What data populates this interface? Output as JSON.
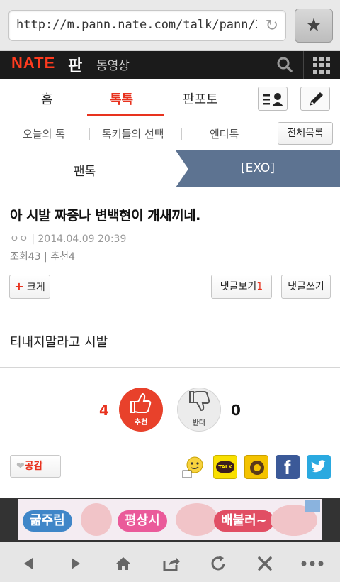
{
  "browser": {
    "url": "http://m.pann.nate.com/talk/pann/3",
    "reload_icon": "reload-icon",
    "star_icon": "star-icon"
  },
  "nate": {
    "logo": "NATE",
    "pan": "판",
    "video": "동영상"
  },
  "tabs": {
    "home": "홈",
    "talk": "톡톡",
    "photo": "판포토"
  },
  "subtabs": {
    "today": "오늘의 톡",
    "choice": "톡커들의 선택",
    "enter": "엔터톡",
    "all_list": "전체목록"
  },
  "breadcrumb": {
    "left": "팬톡",
    "right": "[EXO]"
  },
  "post": {
    "title": "아 시발 짜증나 변백현이 개새끼네.",
    "author": "ㅇㅇ",
    "date": "2014.04.09 20:39",
    "views_label": "조회",
    "views": "43",
    "recommend_label": "추천",
    "recommend": "4",
    "body": "티내지말라고 시발"
  },
  "actions": {
    "bigger_plus": "+",
    "bigger": "크게",
    "view_comments": "댓글보기",
    "comment_count": "1",
    "write_comment": "댓글쓰기"
  },
  "vote": {
    "up_count": "4",
    "up_label": "추천",
    "down_count": "0",
    "down_label": "반대"
  },
  "share": {
    "empathy": "공감",
    "kakao_label": "TALK"
  },
  "ad": {
    "text1": "굶주림",
    "text2": "평상시",
    "text3": "배불러~"
  },
  "colors": {
    "brand_red": "#e8321e",
    "header_dark": "#1b1b1b",
    "crumb_blue": "#5d7391"
  }
}
